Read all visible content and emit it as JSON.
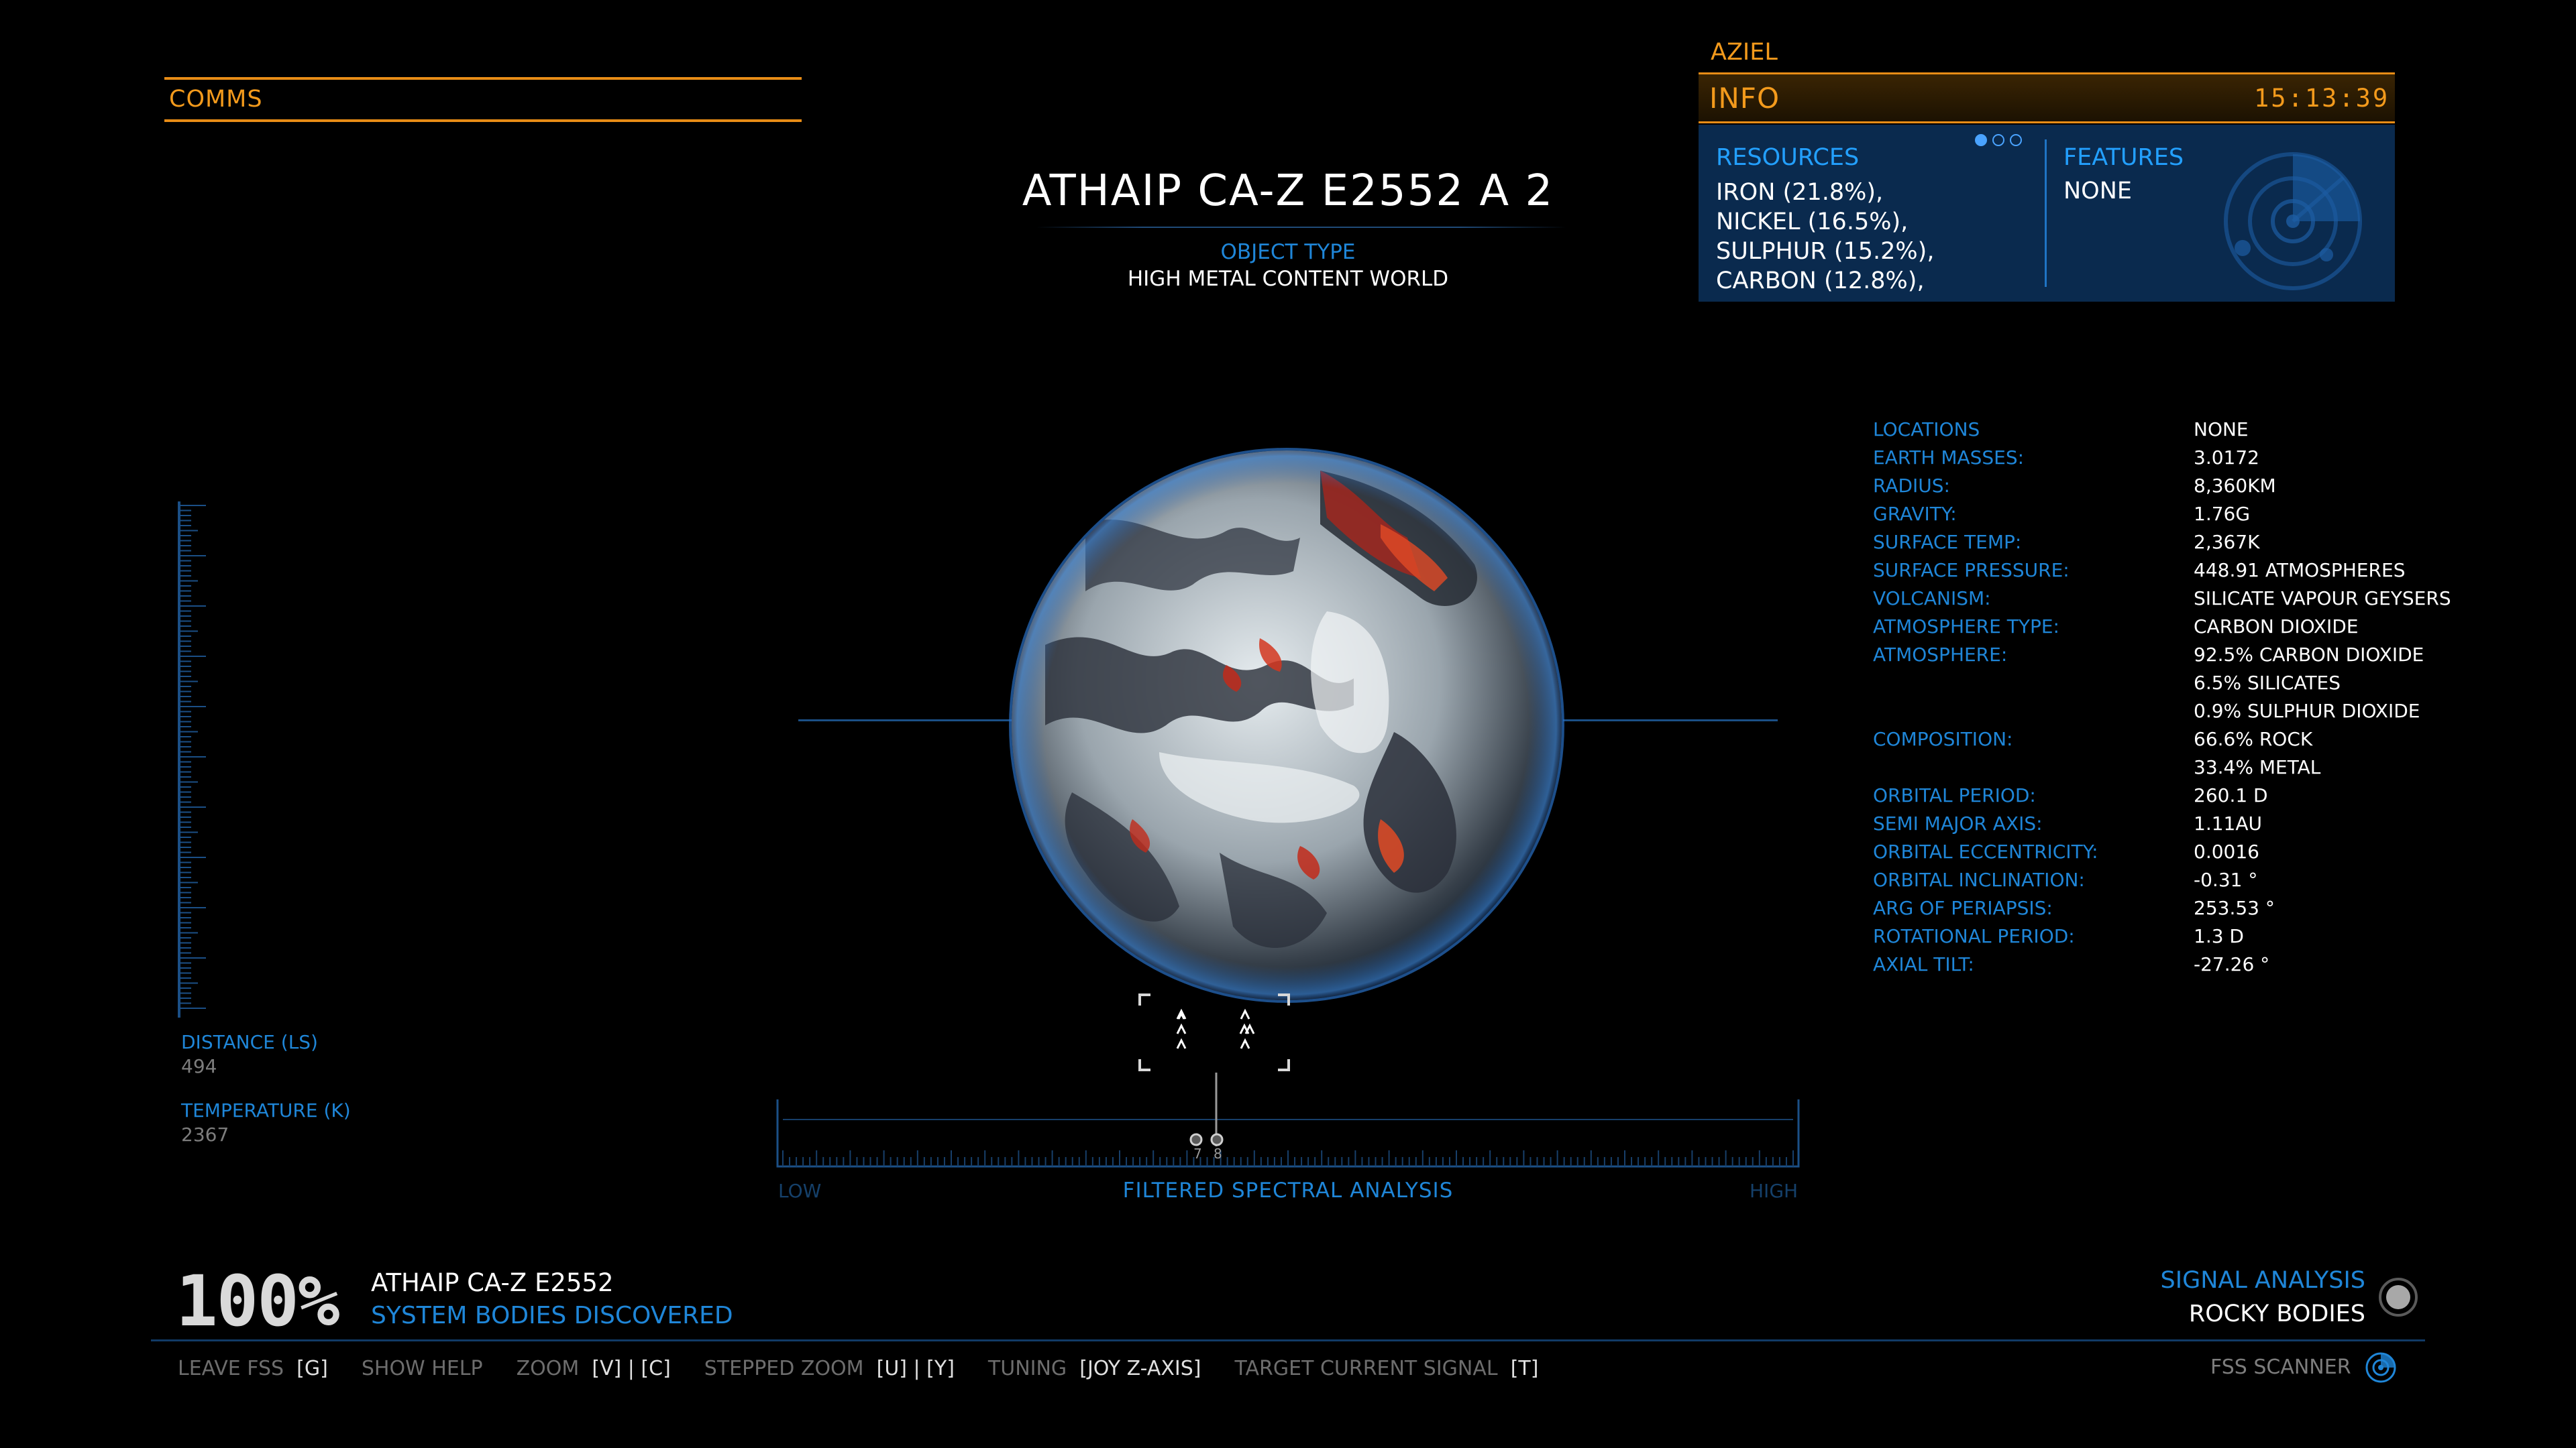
{
  "comms": {
    "label": "COMMS"
  },
  "body": {
    "title": "ATHAIP CA-Z E2552 A 2",
    "object_type_label": "OBJECT TYPE",
    "object_type": "HIGH METAL CONTENT WORLD"
  },
  "info": {
    "commander": "AZIEL",
    "label": "INFO",
    "clock": "15:13:39",
    "resources_title": "RESOURCES",
    "resources": [
      "IRON (21.8%),",
      "NICKEL (16.5%),",
      "SULPHUR (15.2%),",
      "CARBON (12.8%),"
    ],
    "features_title": "FEATURES",
    "features_value": "NONE",
    "page_dots": 3,
    "page_active": 0
  },
  "properties": [
    {
      "label": "LOCATIONS",
      "values": [
        "NONE"
      ]
    },
    {
      "label": "EARTH MASSES:",
      "values": [
        "3.0172"
      ]
    },
    {
      "label": "RADIUS:",
      "values": [
        "8,360KM"
      ]
    },
    {
      "label": "GRAVITY:",
      "values": [
        "1.76G"
      ]
    },
    {
      "label": "SURFACE TEMP:",
      "values": [
        "2,367K"
      ]
    },
    {
      "label": "SURFACE PRESSURE:",
      "values": [
        "448.91 ATMOSPHERES"
      ]
    },
    {
      "label": "VOLCANISM:",
      "values": [
        "SILICATE VAPOUR GEYSERS"
      ]
    },
    {
      "label": "ATMOSPHERE TYPE:",
      "values": [
        "CARBON DIOXIDE"
      ]
    },
    {
      "label": "ATMOSPHERE:",
      "values": [
        "92.5% CARBON DIOXIDE",
        "6.5% SILICATES",
        "0.9% SULPHUR DIOXIDE"
      ]
    },
    {
      "label": "COMPOSITION:",
      "values": [
        "66.6% ROCK",
        "33.4% METAL"
      ]
    },
    {
      "label": "ORBITAL PERIOD:",
      "values": [
        "260.1 D"
      ]
    },
    {
      "label": "SEMI MAJOR AXIS:",
      "values": [
        "1.11AU"
      ]
    },
    {
      "label": "ORBITAL ECCENTRICITY:",
      "values": [
        "0.0016"
      ]
    },
    {
      "label": "ORBITAL INCLINATION:",
      "values": [
        "-0.31 °"
      ]
    },
    {
      "label": "ARG OF PERIAPSIS:",
      "values": [
        "253.53 °"
      ]
    },
    {
      "label": "ROTATIONAL PERIOD:",
      "values": [
        "1.3 D"
      ]
    },
    {
      "label": "AXIAL TILT:",
      "values": [
        "-27.26 °"
      ]
    }
  ],
  "left_readouts": {
    "distance_label": "DISTANCE (LS)",
    "distance": "494",
    "temperature_label": "TEMPERATURE (K)",
    "temperature": "2367"
  },
  "spectrum": {
    "low": "LOW",
    "high": "HIGH",
    "label": "FILTERED SPECTRAL ANALYSIS",
    "marker_a": "7",
    "marker_b": "8"
  },
  "discovery": {
    "percent": "100%",
    "system_name": "ATHAIP CA-Z E2552",
    "status": "SYSTEM BODIES DISCOVERED"
  },
  "signal": {
    "label": "SIGNAL ANALYSIS",
    "value": "ROCKY BODIES"
  },
  "controls": [
    {
      "label": "LEAVE FSS",
      "keys": "[G]"
    },
    {
      "label": "SHOW HELP",
      "keys": ""
    },
    {
      "label": "ZOOM",
      "keys": "[V] | [C]"
    },
    {
      "label": "STEPPED ZOOM",
      "keys": "[U] | [Y]"
    },
    {
      "label": "TUNING",
      "keys": "[JOY Z-AXIS]"
    },
    {
      "label": "TARGET CURRENT SIGNAL",
      "keys": "[T]"
    }
  ],
  "fss": {
    "label": "FSS SCANNER"
  },
  "colors": {
    "accent_orange": "#f39a1c",
    "accent_blue": "#1f86d8",
    "panel_blue": "#0a2a4e"
  },
  "icons": [
    "radar-icon",
    "signal-knob-icon",
    "fss-scanner-icon",
    "targeting-reticle-icon"
  ]
}
